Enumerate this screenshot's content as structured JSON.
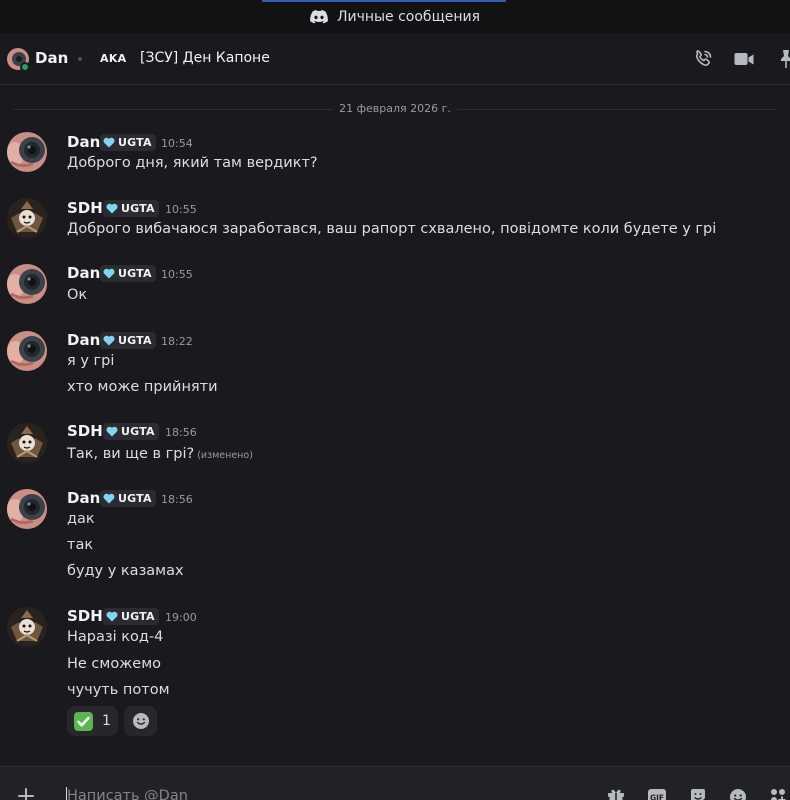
{
  "titlebar": {
    "title": "Личные сообщения",
    "icon": "discord-icon"
  },
  "header": {
    "name": "Dan",
    "tag": "AKA",
    "nickname": "[ЗСУ] Ден Капоне",
    "icons": [
      "phone-call-icon",
      "video-call-icon",
      "pin-icon"
    ]
  },
  "date_divider": "21 февраля 2026 г.",
  "messages": [
    {
      "author": "Dan",
      "badge": "UGTA",
      "time": "10:54",
      "lines": [
        "Доброго дня, який там вердикт?"
      ]
    },
    {
      "author": "SDH",
      "badge": "UGTA",
      "time": "10:55",
      "lines": [
        "Доброго вибачаюся заработався, ваш рапорт схвалено, повідомте коли будете у грі"
      ]
    },
    {
      "author": "Dan",
      "badge": "UGTA",
      "time": "10:55",
      "lines": [
        "Ок"
      ]
    },
    {
      "author": "Dan",
      "badge": "UGTA",
      "time": "18:22",
      "lines": [
        "я у грі",
        "хто може прийняти"
      ]
    },
    {
      "author": "SDH",
      "badge": "UGTA",
      "time": "18:56",
      "lines": [
        "Так, ви ще в грі?"
      ],
      "edited": "(изменено)"
    },
    {
      "author": "Dan",
      "badge": "UGTA",
      "time": "18:56",
      "lines": [
        "дак",
        "так",
        "буду у казамах"
      ]
    },
    {
      "author": "SDH",
      "badge": "UGTA",
      "time": "19:00",
      "lines": [
        "Наразі код-4",
        "Не сможемо",
        "чучуть потом"
      ]
    }
  ],
  "reaction": {
    "emoji": "✅",
    "count": "1"
  },
  "composer": {
    "placeholder": "Написать @Dan",
    "icons": [
      "add-icon",
      "gift-icon",
      "gif-icon",
      "sticker-icon",
      "emoji-icon",
      "apps-icon"
    ]
  },
  "colors": {
    "badge_heart": "#7fd6f0",
    "online": "#23a55a",
    "background": "#1a1a1e"
  }
}
